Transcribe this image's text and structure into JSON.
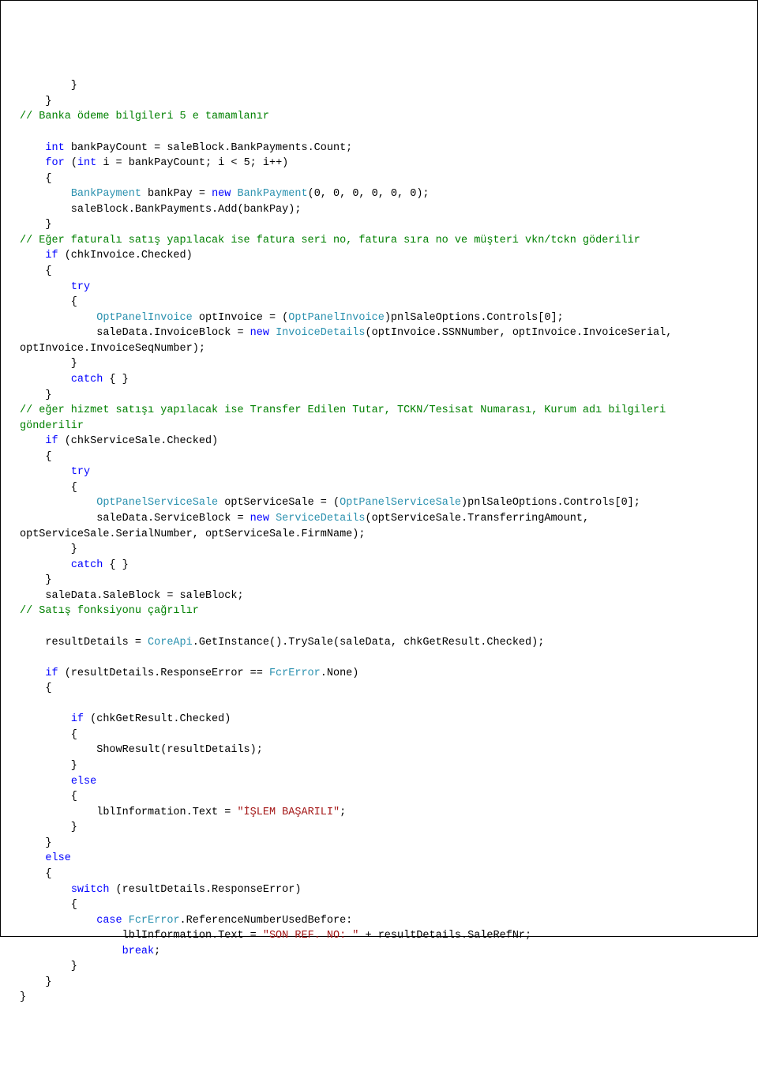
{
  "lines": [
    [
      {
        "cls": "",
        "txt": "        }"
      }
    ],
    [
      {
        "cls": "",
        "txt": "    }"
      }
    ],
    [
      {
        "cls": "c-comment",
        "txt": "// Banka ödeme bilgileri 5 e tamamlanır"
      }
    ],
    [
      {
        "cls": "",
        "txt": ""
      }
    ],
    [
      {
        "cls": "",
        "txt": "    "
      },
      {
        "cls": "c-key",
        "txt": "int"
      },
      {
        "cls": "",
        "txt": " bankPayCount = saleBlock.BankPayments.Count;"
      }
    ],
    [
      {
        "cls": "",
        "txt": "    "
      },
      {
        "cls": "c-key",
        "txt": "for"
      },
      {
        "cls": "",
        "txt": " ("
      },
      {
        "cls": "c-key",
        "txt": "int"
      },
      {
        "cls": "",
        "txt": " i = bankPayCount; i < 5; i++)"
      }
    ],
    [
      {
        "cls": "",
        "txt": "    {"
      }
    ],
    [
      {
        "cls": "",
        "txt": "        "
      },
      {
        "cls": "c-type",
        "txt": "BankPayment"
      },
      {
        "cls": "",
        "txt": " bankPay = "
      },
      {
        "cls": "c-key",
        "txt": "new"
      },
      {
        "cls": "",
        "txt": " "
      },
      {
        "cls": "c-type",
        "txt": "BankPayment"
      },
      {
        "cls": "",
        "txt": "(0, 0, 0, 0, 0, 0);"
      }
    ],
    [
      {
        "cls": "",
        "txt": "        saleBlock.BankPayments.Add(bankPay);"
      }
    ],
    [
      {
        "cls": "",
        "txt": "    }"
      }
    ],
    [
      {
        "cls": "c-comment",
        "txt": "// Eğer faturalı satış yapılacak ise fatura seri no, fatura sıra no ve müşteri vkn/tckn göderilir"
      }
    ],
    [
      {
        "cls": "",
        "txt": "    "
      },
      {
        "cls": "c-key",
        "txt": "if"
      },
      {
        "cls": "",
        "txt": " (chkInvoice.Checked)"
      }
    ],
    [
      {
        "cls": "",
        "txt": "    {"
      }
    ],
    [
      {
        "cls": "",
        "txt": "        "
      },
      {
        "cls": "c-key",
        "txt": "try"
      }
    ],
    [
      {
        "cls": "",
        "txt": "        {"
      }
    ],
    [
      {
        "cls": "",
        "txt": "            "
      },
      {
        "cls": "c-type",
        "txt": "OptPanelInvoice"
      },
      {
        "cls": "",
        "txt": " optInvoice = ("
      },
      {
        "cls": "c-type",
        "txt": "OptPanelInvoice"
      },
      {
        "cls": "",
        "txt": ")pnlSaleOptions.Controls[0];"
      }
    ],
    [
      {
        "cls": "",
        "txt": "            saleData.InvoiceBlock = "
      },
      {
        "cls": "c-key",
        "txt": "new"
      },
      {
        "cls": "",
        "txt": " "
      },
      {
        "cls": "c-type",
        "txt": "InvoiceDetails"
      },
      {
        "cls": "",
        "txt": "(optInvoice.SSNNumber, optInvoice.InvoiceSerial, "
      }
    ],
    [
      {
        "cls": "",
        "txt": "optInvoice.InvoiceSeqNumber);"
      }
    ],
    [
      {
        "cls": "",
        "txt": "        }"
      }
    ],
    [
      {
        "cls": "",
        "txt": "        "
      },
      {
        "cls": "c-key",
        "txt": "catch"
      },
      {
        "cls": "",
        "txt": " { }"
      }
    ],
    [
      {
        "cls": "",
        "txt": "    }"
      }
    ],
    [
      {
        "cls": "c-comment",
        "txt": "// eğer hizmet satışı yapılacak ise Transfer Edilen Tutar, TCKN/Tesisat Numarası, Kurum adı bilgileri "
      }
    ],
    [
      {
        "cls": "c-comment",
        "txt": "gönderilir"
      }
    ],
    [
      {
        "cls": "",
        "txt": "    "
      },
      {
        "cls": "c-key",
        "txt": "if"
      },
      {
        "cls": "",
        "txt": " (chkServiceSale.Checked)"
      }
    ],
    [
      {
        "cls": "",
        "txt": "    {"
      }
    ],
    [
      {
        "cls": "",
        "txt": "        "
      },
      {
        "cls": "c-key",
        "txt": "try"
      }
    ],
    [
      {
        "cls": "",
        "txt": "        {"
      }
    ],
    [
      {
        "cls": "",
        "txt": "            "
      },
      {
        "cls": "c-type",
        "txt": "OptPanelServiceSale"
      },
      {
        "cls": "",
        "txt": " optServiceSale = ("
      },
      {
        "cls": "c-type",
        "txt": "OptPanelServiceSale"
      },
      {
        "cls": "",
        "txt": ")pnlSaleOptions.Controls[0];"
      }
    ],
    [
      {
        "cls": "",
        "txt": "            saleData.ServiceBlock = "
      },
      {
        "cls": "c-key",
        "txt": "new"
      },
      {
        "cls": "",
        "txt": " "
      },
      {
        "cls": "c-type",
        "txt": "ServiceDetails"
      },
      {
        "cls": "",
        "txt": "(optServiceSale.TransferringAmount, "
      }
    ],
    [
      {
        "cls": "",
        "txt": "optServiceSale.SerialNumber, optServiceSale.FirmName);"
      }
    ],
    [
      {
        "cls": "",
        "txt": "        }"
      }
    ],
    [
      {
        "cls": "",
        "txt": "        "
      },
      {
        "cls": "c-key",
        "txt": "catch"
      },
      {
        "cls": "",
        "txt": " { }"
      }
    ],
    [
      {
        "cls": "",
        "txt": "    }"
      }
    ],
    [
      {
        "cls": "",
        "txt": "    saleData.SaleBlock = saleBlock;"
      }
    ],
    [
      {
        "cls": "c-comment",
        "txt": "// Satış fonksiyonu çağrılır"
      }
    ],
    [
      {
        "cls": "",
        "txt": ""
      }
    ],
    [
      {
        "cls": "",
        "txt": "    resultDetails = "
      },
      {
        "cls": "c-type",
        "txt": "CoreApi"
      },
      {
        "cls": "",
        "txt": ".GetInstance().TrySale(saleData, chkGetResult.Checked);"
      }
    ],
    [
      {
        "cls": "",
        "txt": ""
      }
    ],
    [
      {
        "cls": "",
        "txt": "    "
      },
      {
        "cls": "c-key",
        "txt": "if"
      },
      {
        "cls": "",
        "txt": " (resultDetails.ResponseError == "
      },
      {
        "cls": "c-type",
        "txt": "FcrError"
      },
      {
        "cls": "",
        "txt": ".None)"
      }
    ],
    [
      {
        "cls": "",
        "txt": "    {"
      }
    ],
    [
      {
        "cls": "",
        "txt": ""
      }
    ],
    [
      {
        "cls": "",
        "txt": "        "
      },
      {
        "cls": "c-key",
        "txt": "if"
      },
      {
        "cls": "",
        "txt": " (chkGetResult.Checked)"
      }
    ],
    [
      {
        "cls": "",
        "txt": "        {"
      }
    ],
    [
      {
        "cls": "",
        "txt": "            ShowResult(resultDetails);"
      }
    ],
    [
      {
        "cls": "",
        "txt": "        }"
      }
    ],
    [
      {
        "cls": "",
        "txt": "        "
      },
      {
        "cls": "c-key",
        "txt": "else"
      }
    ],
    [
      {
        "cls": "",
        "txt": "        {"
      }
    ],
    [
      {
        "cls": "",
        "txt": "            lblInformation.Text = "
      },
      {
        "cls": "c-str",
        "txt": "\"İŞLEM BAŞARILI\""
      },
      {
        "cls": "",
        "txt": ";"
      }
    ],
    [
      {
        "cls": "",
        "txt": "        }"
      }
    ],
    [
      {
        "cls": "",
        "txt": "    }"
      }
    ],
    [
      {
        "cls": "",
        "txt": "    "
      },
      {
        "cls": "c-key",
        "txt": "else"
      }
    ],
    [
      {
        "cls": "",
        "txt": "    {"
      }
    ],
    [
      {
        "cls": "",
        "txt": "        "
      },
      {
        "cls": "c-key",
        "txt": "switch"
      },
      {
        "cls": "",
        "txt": " (resultDetails.ResponseError)"
      }
    ],
    [
      {
        "cls": "",
        "txt": "        {"
      }
    ],
    [
      {
        "cls": "",
        "txt": "            "
      },
      {
        "cls": "c-key",
        "txt": "case"
      },
      {
        "cls": "",
        "txt": " "
      },
      {
        "cls": "c-type",
        "txt": "FcrError"
      },
      {
        "cls": "",
        "txt": ".ReferenceNumberUsedBefore:"
      }
    ],
    [
      {
        "cls": "",
        "txt": "                lblInformation.Text = "
      },
      {
        "cls": "c-str",
        "txt": "\"SON REF. NO: \""
      },
      {
        "cls": "",
        "txt": " + resultDetails.SaleRefNr;"
      }
    ],
    [
      {
        "cls": "",
        "txt": "                "
      },
      {
        "cls": "c-key",
        "txt": "break"
      },
      {
        "cls": "",
        "txt": ";"
      }
    ],
    [
      {
        "cls": "",
        "txt": "        }"
      }
    ],
    [
      {
        "cls": "",
        "txt": "    }"
      }
    ],
    [
      {
        "cls": "",
        "txt": "}"
      }
    ]
  ]
}
